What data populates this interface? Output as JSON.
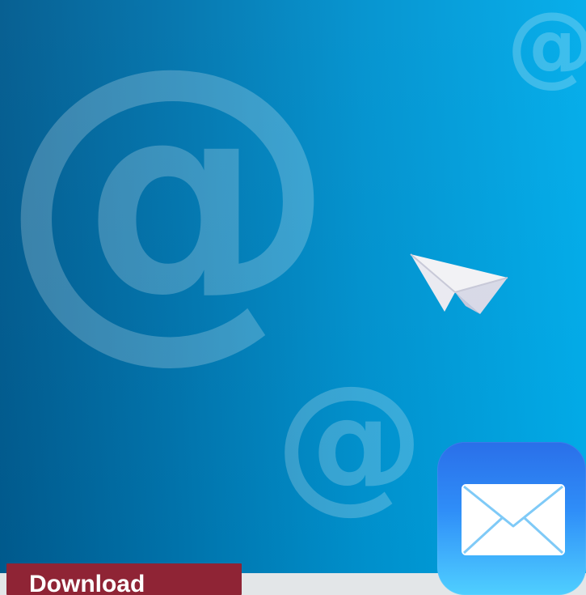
{
  "page": {
    "hero_background_left": "#005b8f",
    "hero_background_right": "#00acea",
    "decorative_symbols": {
      "large": "@",
      "small_top": "@",
      "small_mid": "@"
    },
    "icons": {
      "paper_plane": "paper-plane-icon",
      "mail_app": "mail-app-icon"
    },
    "download_button": {
      "label": "Download",
      "background_color": "#8f2435"
    },
    "bottom_bar_color": "#e3e6e8",
    "mail_icon_gradient_top": "#2a6fe9",
    "mail_icon_gradient_bottom": "#4fcfff"
  }
}
